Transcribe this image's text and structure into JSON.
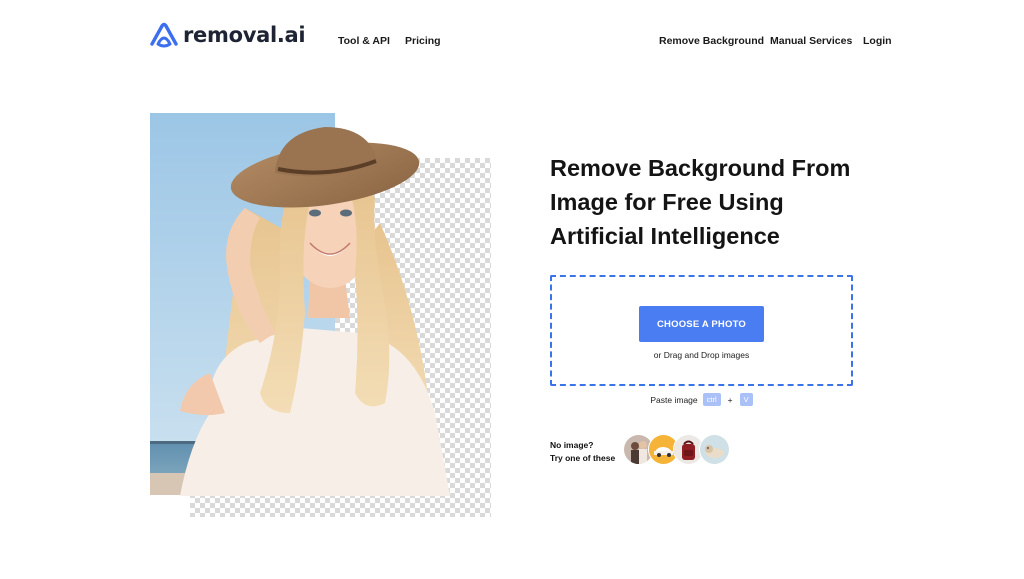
{
  "header": {
    "logo_text": "removal.ai",
    "logo_icon": "removal-ai-logo-icon",
    "nav_left": [
      "Tool & API",
      "Pricing"
    ],
    "nav_right": [
      "Remove Background",
      "Manual Services",
      "Login"
    ]
  },
  "hero": {
    "headline_lines": [
      "Remove Background From",
      "Image for Free Using",
      "Artificial Intelligence"
    ]
  },
  "upload": {
    "button_label": "CHOOSE A PHOTO",
    "drag_text": "or Drag and Drop images",
    "paste_label": "Paste image",
    "key_ctrl": "ctrl",
    "plus": "+",
    "key_v": "V"
  },
  "samples": {
    "label_line1": "No image?",
    "label_line2": "Try one of these",
    "items": [
      "sample-people",
      "sample-car",
      "sample-bag",
      "sample-dog"
    ]
  },
  "colors": {
    "accent": "#4b7df2",
    "dropzone_border": "#3b73e8",
    "key_badge": "#a9c1f7",
    "text": "#141414"
  }
}
